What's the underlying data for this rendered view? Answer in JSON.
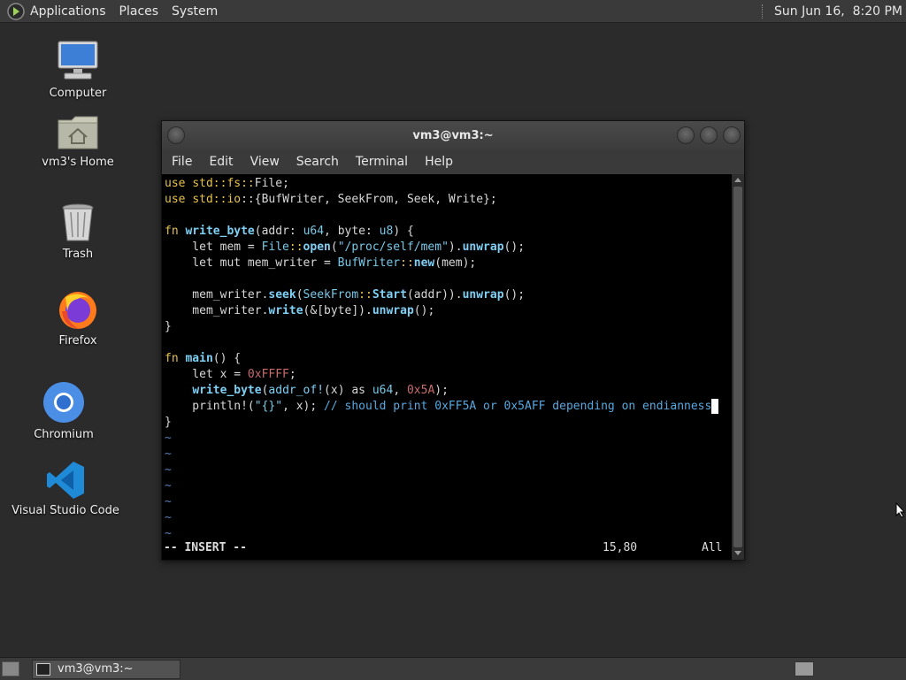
{
  "top_panel": {
    "menus": [
      "Applications",
      "Places",
      "System"
    ],
    "clock": "Sun Jun 16,  8:20 PM"
  },
  "desktop_icons": [
    {
      "label": "Computer",
      "icon": "computer-icon"
    },
    {
      "label": "vm3's Home",
      "icon": "home-folder-icon"
    },
    {
      "label": "Trash",
      "icon": "trash-icon"
    },
    {
      "label": "Firefox",
      "icon": "firefox-icon"
    },
    {
      "label": "Chromium",
      "icon": "chromium-icon"
    },
    {
      "label": "Visual Studio Code",
      "icon": "vscode-icon"
    }
  ],
  "terminal": {
    "title": "vm3@vm3:~",
    "menu": [
      "File",
      "Edit",
      "View",
      "Search",
      "Terminal",
      "Help"
    ],
    "mode": "-- INSERT --",
    "position": "15,80",
    "scroll": "All",
    "code": {
      "l1": [
        "use",
        " ",
        "std",
        "::",
        "fs",
        "::",
        "File;"
      ],
      "l2": [
        "use",
        " ",
        "std",
        "::",
        "io",
        "::{BufWriter, SeekFrom, Seek, Write};"
      ],
      "l4": [
        "fn",
        " ",
        "write_byte",
        "(addr: ",
        "u64",
        ", byte: ",
        "u8",
        ") {"
      ],
      "l5": [
        "    let mem = ",
        "File",
        "::",
        "open",
        "(",
        "\"/proc/self/mem\"",
        ").",
        "unwrap",
        "();"
      ],
      "l6": [
        "    let mut mem_writer = ",
        "BufWriter",
        "::",
        "new",
        "(mem);"
      ],
      "l8": [
        "    mem_writer.",
        "seek",
        "(",
        "SeekFrom",
        "::",
        "Start",
        "(addr)).",
        "unwrap",
        "();"
      ],
      "l9": [
        "    mem_writer.",
        "write",
        "(&[byte]).",
        "unwrap",
        "();"
      ],
      "l10": [
        "}"
      ],
      "l12": [
        "fn",
        " ",
        "main",
        "() {"
      ],
      "l13": [
        "    let x = ",
        "0xFFFF",
        ";"
      ],
      "l14": [
        "    ",
        "write_byte",
        "(",
        "addr_of!",
        "(x) as ",
        "u64",
        ", ",
        "0x5A",
        ");"
      ],
      "l15": [
        "    println!(",
        "\"{}\"",
        ", x); ",
        "// should print 0xFF5A or 0x5AFF depending on endianness"
      ],
      "l16": [
        "}"
      ],
      "tilde": "~"
    }
  },
  "taskbar": {
    "task_label": "vm3@vm3:~"
  }
}
